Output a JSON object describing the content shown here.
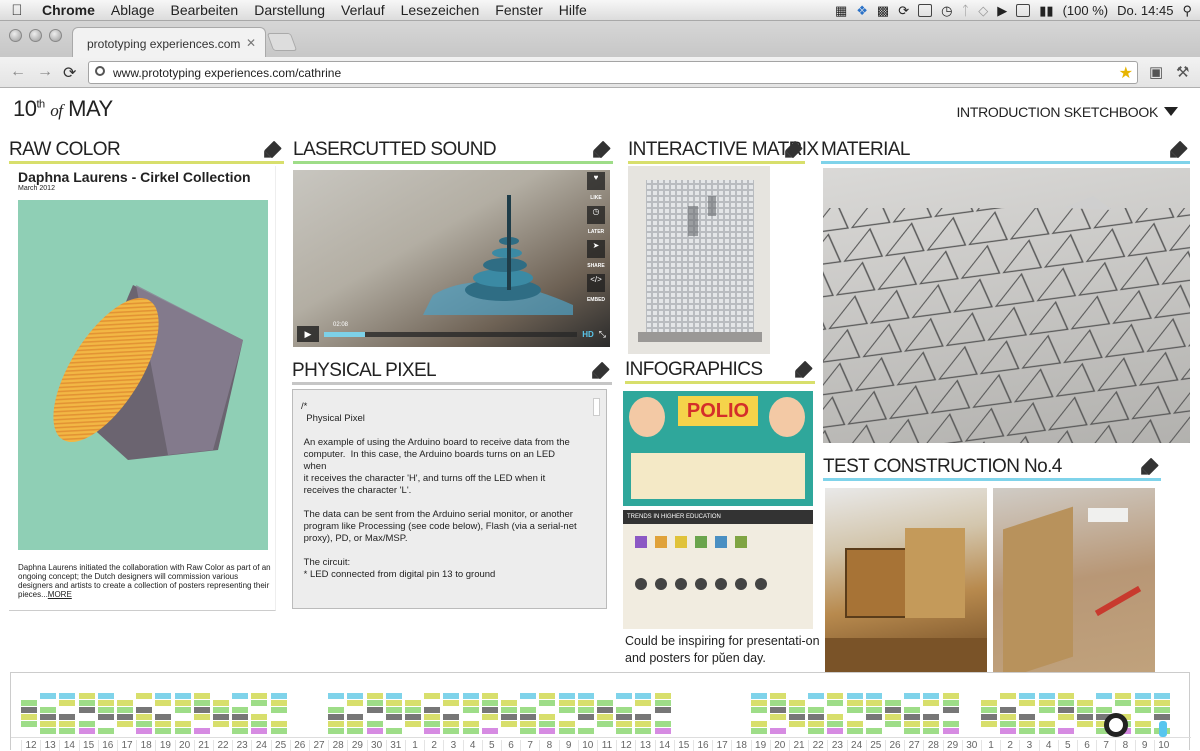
{
  "menubar": {
    "app": "Chrome",
    "items": [
      "Ablage",
      "Bearbeiten",
      "Darstellung",
      "Verlauf",
      "Lesezeichen",
      "Fenster",
      "Hilfe"
    ],
    "battery": "(100 %)",
    "clock": "Do. 14:45"
  },
  "browser": {
    "tab_title": "prototyping experiences.com",
    "url": "www.prototyping experiences.com/cathrine"
  },
  "page": {
    "date_day": "10",
    "date_suffix": "th",
    "date_of": "of",
    "date_month": "MAY",
    "sketchbook": "INTRODUCTION SKETCHBOOK"
  },
  "cards": {
    "raw_color": {
      "title": "RAW COLOR",
      "heading": "Daphna Laurens - Cirkel Collection",
      "subdate": "March 2012",
      "desc": "Daphna Laurens initiated the collaboration with Raw Color as part of an ongoing concept; the Dutch designers will commission various designers and artists to create a collection of posters representing their pieces...",
      "more": "MORE"
    },
    "lasercut": {
      "title": "LASERCUTTED SOUND",
      "time": "02:08",
      "hd": "HD",
      "side_like": "LIKE",
      "side_later": "LATER",
      "side_share": "SHARE",
      "side_embed": "EMBED"
    },
    "matrix": {
      "title": "INTERACTIVE MATRIX"
    },
    "material": {
      "title": "MATERIAL"
    },
    "physical": {
      "title": "PHYSICAL PIXEL",
      "code": "/*\n  Physical Pixel\n\n An example of using the Arduino board to receive data from the\n computer.  In this case, the Arduino boards turns on an LED\n when\n it receives the character 'H', and turns off the LED when it\n receives the character 'L'.\n\n The data can be sent from the Arduino serial monitor, or another\n program like Processing (see code below), Flash (via a serial-net\n proxy), PD, or Max/MSP.\n\n The circuit:\n * LED connected from digital pin 13 to ground"
    },
    "infographics": {
      "title": "INFOGRAPHICS",
      "polio": "POLIO",
      "trends": "TRENDS IN HIGHER EDUCATION",
      "caption": "Could be inspiring for presentati-on and posters for pŭen day."
    },
    "test": {
      "title": "TEST CONSTRUCTION No.4"
    }
  },
  "colors": {
    "yellow": "#d8df6c",
    "green": "#9edd88",
    "blue": "#7fd3ea",
    "teal": "#8fcfb5"
  },
  "timeline": {
    "numbers": [
      "12",
      "13",
      "14",
      "15",
      "16",
      "17",
      "18",
      "19",
      "20",
      "21",
      "22",
      "23",
      "24",
      "25",
      "26",
      "27",
      "28",
      "29",
      "30",
      "31",
      "1",
      "2",
      "3",
      "4",
      "5",
      "6",
      "7",
      "8",
      "9",
      "10",
      "11",
      "12",
      "13",
      "14",
      "15",
      "16",
      "17",
      "18",
      "19",
      "20",
      "21",
      "22",
      "23",
      "24",
      "25",
      "26",
      "27",
      "28",
      "29",
      "30",
      "1",
      "2",
      "3",
      "4",
      "5",
      "6",
      "7",
      "8",
      "9",
      "10"
    ]
  }
}
